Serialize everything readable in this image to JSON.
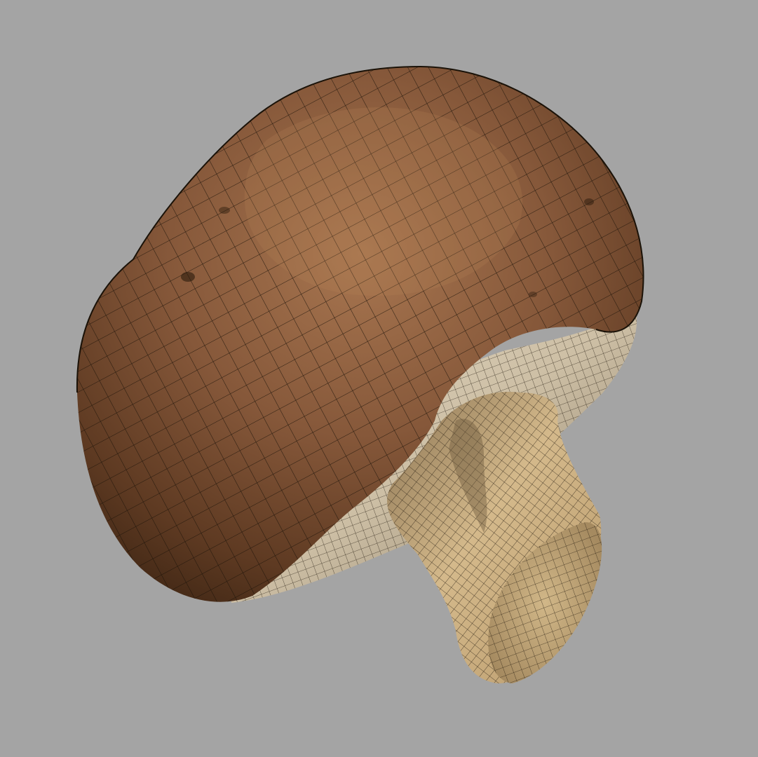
{
  "viewport": {
    "background": "#a4a4a4"
  },
  "model": {
    "cap_color": "#7a5030",
    "cap_highlight": "#a87650",
    "cap_shadow": "#3f2614",
    "gill_color": "#cdbfa5",
    "stem_color": "#c8ab7c",
    "stem_shadow": "#8a7352",
    "wire_color": "#1a1208",
    "wireframe": true
  }
}
